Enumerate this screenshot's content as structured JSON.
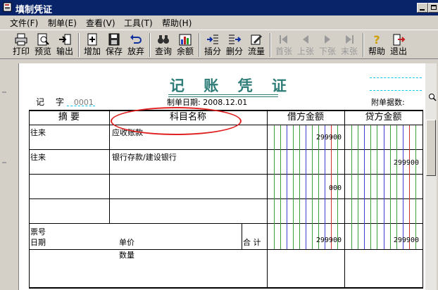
{
  "window": {
    "title": "填制凭证"
  },
  "menu": [
    {
      "label": "文件(F)"
    },
    {
      "label": "制单(E)"
    },
    {
      "label": "查看(V)"
    },
    {
      "label": "工具(T)"
    },
    {
      "label": "帮助(H)"
    }
  ],
  "toolbar": [
    {
      "label": "打印",
      "icon": "printer-icon",
      "enabled": true
    },
    {
      "label": "预览",
      "icon": "preview-icon",
      "enabled": true
    },
    {
      "label": "输出",
      "icon": "output-icon",
      "enabled": true
    },
    {
      "label": "增加",
      "icon": "add-icon",
      "enabled": true
    },
    {
      "label": "保存",
      "icon": "save-icon",
      "enabled": true
    },
    {
      "label": "放弃",
      "icon": "undo-icon",
      "enabled": true
    },
    {
      "label": "查询",
      "icon": "binoculars-icon",
      "enabled": true
    },
    {
      "label": "余额",
      "icon": "balance-chart-icon",
      "enabled": true
    },
    {
      "label": "插分",
      "icon": "insert-row-icon",
      "enabled": true
    },
    {
      "label": "删分",
      "icon": "delete-row-icon",
      "enabled": true
    },
    {
      "label": "流量",
      "icon": "flow-icon",
      "enabled": true
    },
    {
      "label": "首张",
      "icon": "first-icon",
      "enabled": false
    },
    {
      "label": "上张",
      "icon": "prev-icon",
      "enabled": false
    },
    {
      "label": "下张",
      "icon": "next-icon",
      "enabled": false
    },
    {
      "label": "末张",
      "icon": "last-icon",
      "enabled": false
    },
    {
      "label": "帮助",
      "icon": "help-icon",
      "enabled": true
    },
    {
      "label": "退出",
      "icon": "exit-icon",
      "enabled": true
    }
  ],
  "voucher": {
    "title": "记 账 凭 证",
    "type_label": "记 字",
    "number": "0001",
    "date_label": "制单日期:",
    "date": "2008.12.01",
    "attachments_label": "附单据数:",
    "headers": {
      "summary": "摘 要",
      "account": "科目名称",
      "debit": "借方金额",
      "credit": "贷方金额"
    },
    "rows": [
      {
        "summary": "往来",
        "account": "应收账款",
        "debit": "299900",
        "credit": ""
      },
      {
        "summary": "往来",
        "account": "银行存款/建设银行",
        "debit": "",
        "credit": "299900"
      },
      {
        "summary": "",
        "account": "",
        "debit": "000",
        "credit": ""
      },
      {
        "summary": "",
        "account": "",
        "debit": "",
        "credit": ""
      }
    ],
    "footer": {
      "ticket_label": "票号",
      "date_label": "日期",
      "unit_price_label": "单价",
      "quantity_label": "数量",
      "total_label": "合 计",
      "total_debit": "299900",
      "total_credit": "299900"
    }
  }
}
